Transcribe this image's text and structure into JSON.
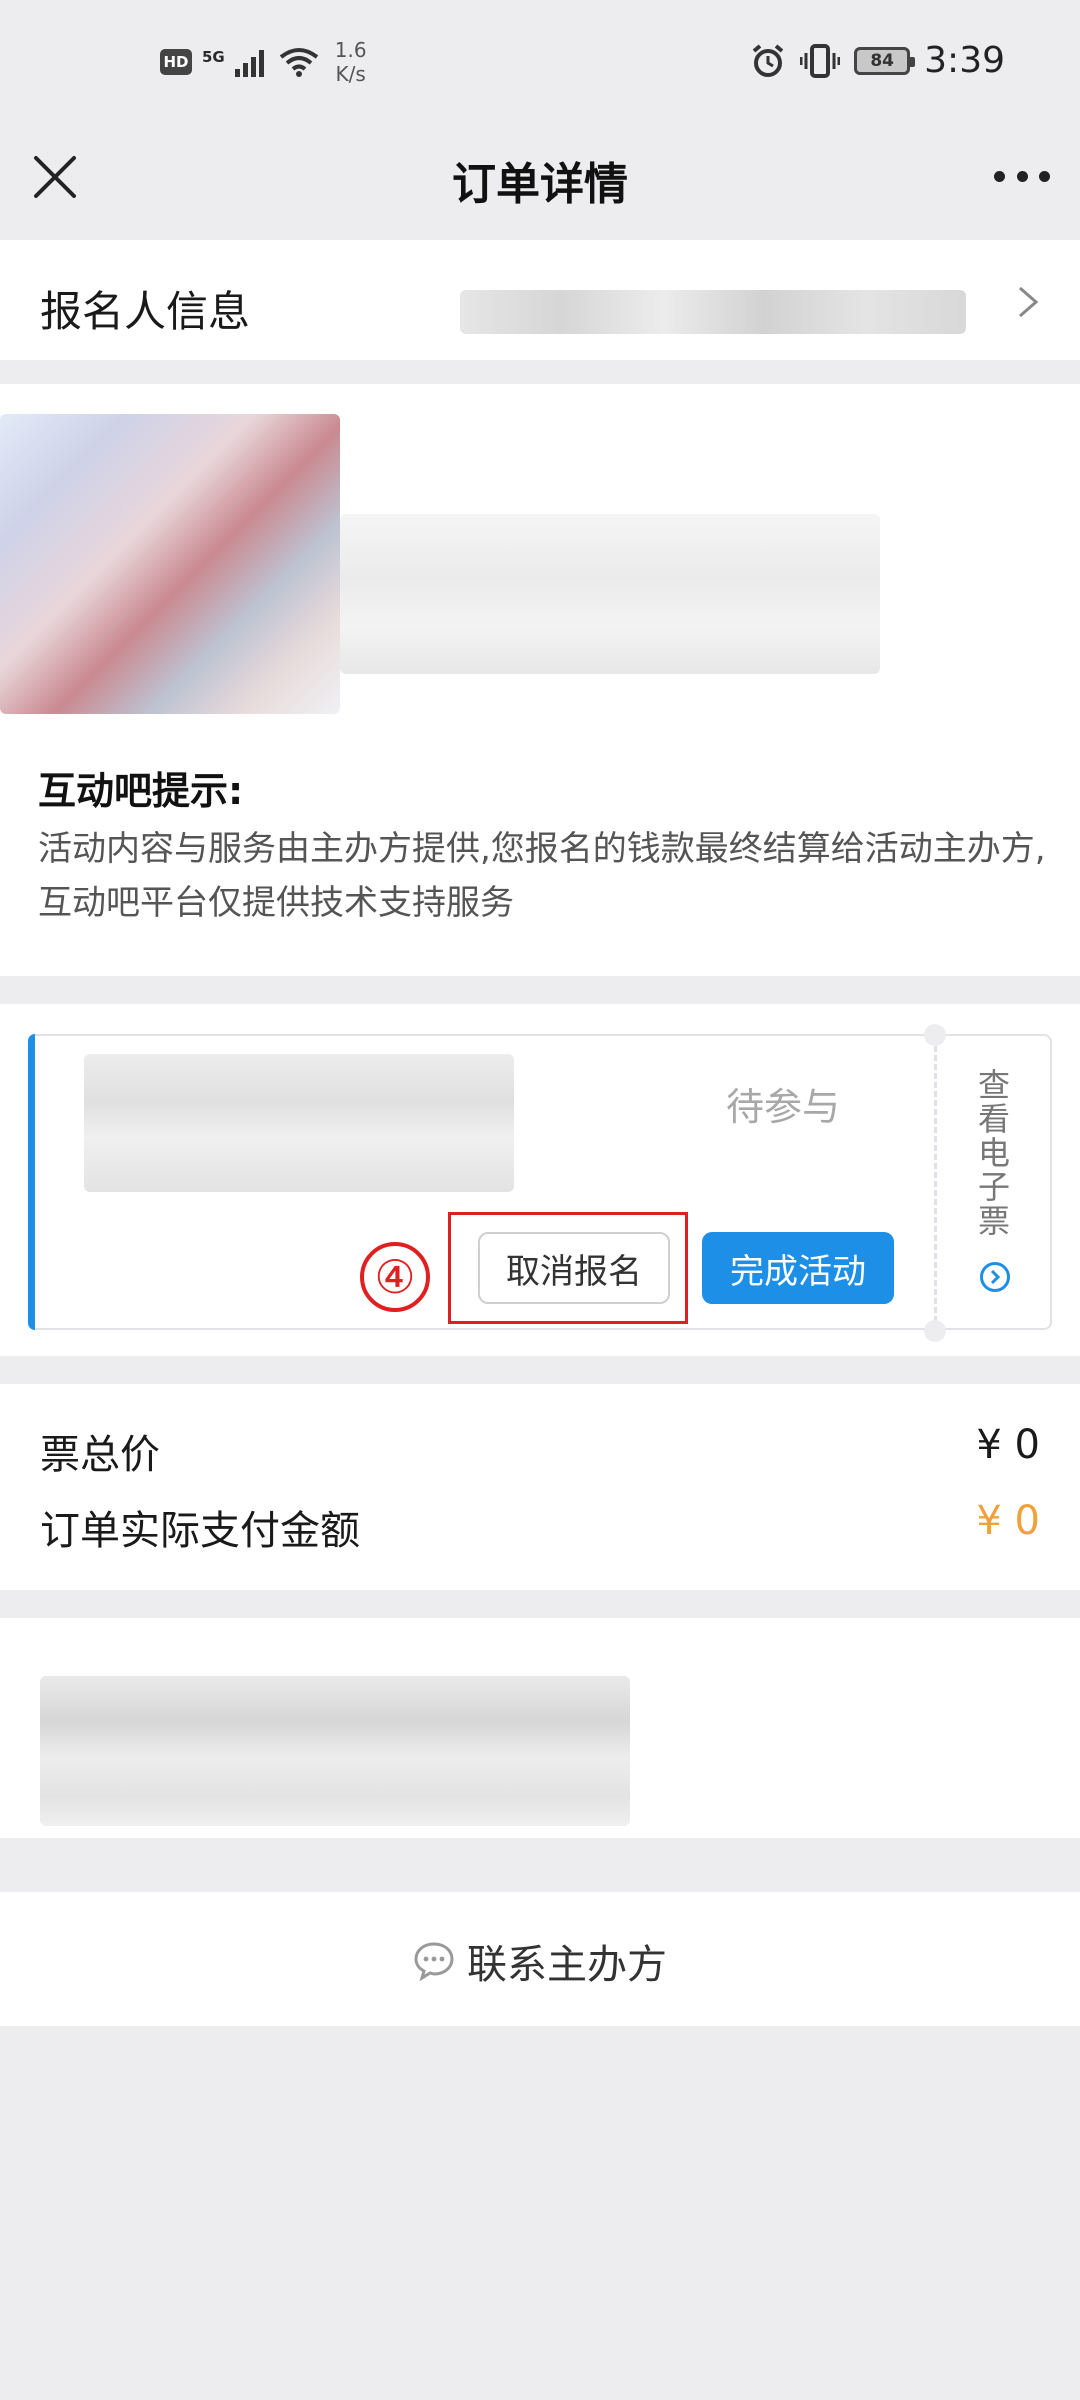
{
  "status_bar": {
    "hd_badge": "HD",
    "network_type": "5G",
    "speed_value": "1.6",
    "speed_unit": "K/s",
    "battery": "84",
    "time": "3:39"
  },
  "nav": {
    "title": "订单详情"
  },
  "registrant": {
    "label": "报名人信息"
  },
  "tips": {
    "title": "互动吧提示:",
    "body": "活动内容与服务由主办方提供,您报名的钱款最终结算给活动主办方,互动吧平台仅提供技术支持服务"
  },
  "ticket": {
    "status": "待参与",
    "annotation_number": "④",
    "cancel_label": "取消报名",
    "complete_label": "完成活动",
    "eticket_label": "查看电子票"
  },
  "price": {
    "total_label": "票总价",
    "total_value": "¥ 0",
    "paid_label": "订单实际支付金额",
    "paid_value": "¥ 0"
  },
  "contact": {
    "label": "联系主办方"
  },
  "colors": {
    "accent": "#1d8fe6",
    "orange": "#f0a13a",
    "annotation": "#e02020",
    "background": "#ededf0"
  }
}
